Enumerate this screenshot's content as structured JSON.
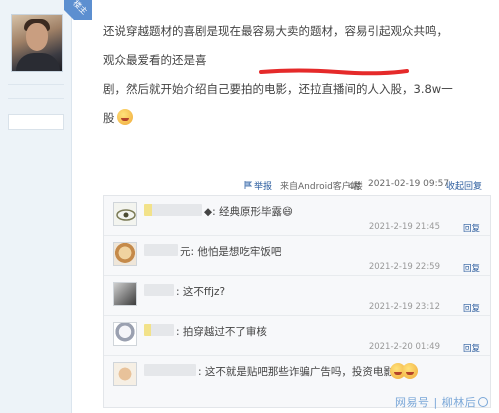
{
  "badge": {
    "text": "楼主"
  },
  "post": {
    "line1": "还说穿越题材的喜剧是现在最容易大卖的题材，容易引起观众共鸣，观众最爱看的还是喜",
    "line2": "剧，然后就开始介绍自己要拍的电影，还拉直播间的人入股，3.8w一股"
  },
  "meta": {
    "report": "举报",
    "source": "来自Android客户端",
    "floor": "4楼",
    "datetime": "2021-02-19 09:57",
    "collapse": "收起回复"
  },
  "replies": [
    {
      "text": "◆: 经典原形毕露😄",
      "time": "2021-2-19 21:45",
      "reply": "回复"
    },
    {
      "text": "元: 他怕是想吃牢饭吧",
      "time": "2021-2-19 22:59",
      "reply": "回复"
    },
    {
      "text": ": 这不ffjz?",
      "time": "2021-2-19 23:12",
      "reply": "回复"
    },
    {
      "text": ": 拍穿越过不了审核",
      "time": "2021-2-20 01:49",
      "reply": "回复"
    },
    {
      "text": ": 这不就是贴吧那些诈骗广告吗，投资电影",
      "time": "",
      "reply": ""
    }
  ],
  "watermark": {
    "text": "网易号 | 柳林后"
  },
  "colors": {
    "accent": "#2b5c9e",
    "underline": "#e52a2a",
    "badge": "#5c8fd0"
  }
}
